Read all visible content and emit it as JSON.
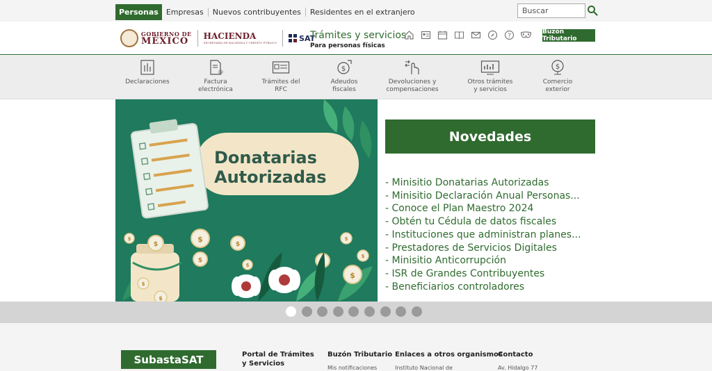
{
  "topnav": {
    "tabs": [
      "Personas",
      "Empresas",
      "Nuevos contribuyentes",
      "Residentes en el extranjero"
    ],
    "search_placeholder": "Buscar"
  },
  "header": {
    "gob_line1": "GOBIERNO DE",
    "gob_line2": "MÉXICO",
    "hacienda": "HACIENDA",
    "hacienda_sub": "SECRETARÍA DE HACIENDA Y CRÉDITO PÚBLICO",
    "sat": "SAT",
    "title": "Trámites y servicios",
    "subtitle": "Para personas físicas",
    "icons": [
      "home-icon",
      "id-card-icon",
      "calendar-icon",
      "book-icon",
      "mail-icon",
      "compass-icon",
      "help-icon",
      "mask-icon"
    ],
    "buzon": "Buzón Tributario"
  },
  "nav": [
    {
      "line1": "Declaraciones",
      "line2": "",
      "icon": "declaraciones-icon"
    },
    {
      "line1": "Factura",
      "line2": "electrónica",
      "icon": "factura-icon"
    },
    {
      "line1": "Trámites del",
      "line2": "RFC",
      "icon": "rfc-icon"
    },
    {
      "line1": "Adeudos",
      "line2": "fiscales",
      "icon": "adeudos-icon"
    },
    {
      "line1": "Devoluciones y",
      "line2": "compensaciones",
      "icon": "devoluciones-icon"
    },
    {
      "line1": "Otros trámites",
      "line2": "y servicios",
      "icon": "otros-icon"
    },
    {
      "line1": "Comercio",
      "line2": "exterior",
      "icon": "comercio-icon"
    }
  ],
  "banner": {
    "line1": "Donatarias",
    "line2": "Autorizadas",
    "coin_symbol": "$",
    "colors": {
      "bg": "#1f7a5e",
      "pill": "#f3e6c8",
      "text": "#2f5a4a"
    }
  },
  "novedades": {
    "title": "Novedades",
    "items": [
      "- Minisitio Donatarias Autorizadas",
      "- Minisitio Declaración Anual Personas...",
      "- Conoce el Plan Maestro 2024",
      "- Obtén tu Cédula de datos fiscales",
      "- Instituciones que administran planes...",
      "- Prestadores de Servicios Digitales",
      "- Minisitio Anticorrupción",
      "- ISR de Grandes Contribuyentes",
      "- Beneficiarios controladores"
    ]
  },
  "carousel": {
    "dot_count": 9,
    "active_index": 0
  },
  "footer": {
    "subasta": "SubastaSAT",
    "col1_line1": "Portal de Trámites",
    "col1_line2": "y Servicios",
    "col2": "Buzón Tributario",
    "col2_sub": "Mis notificaciones",
    "col3": "Enlaces a otros organismos",
    "col3_sub": "Instituto Nacional de",
    "col4": "Contacto",
    "col4_sub": "Av. Hidalgo 77"
  },
  "colors": {
    "primary": "#2f6b2f",
    "guinda": "#6b1f2a"
  }
}
